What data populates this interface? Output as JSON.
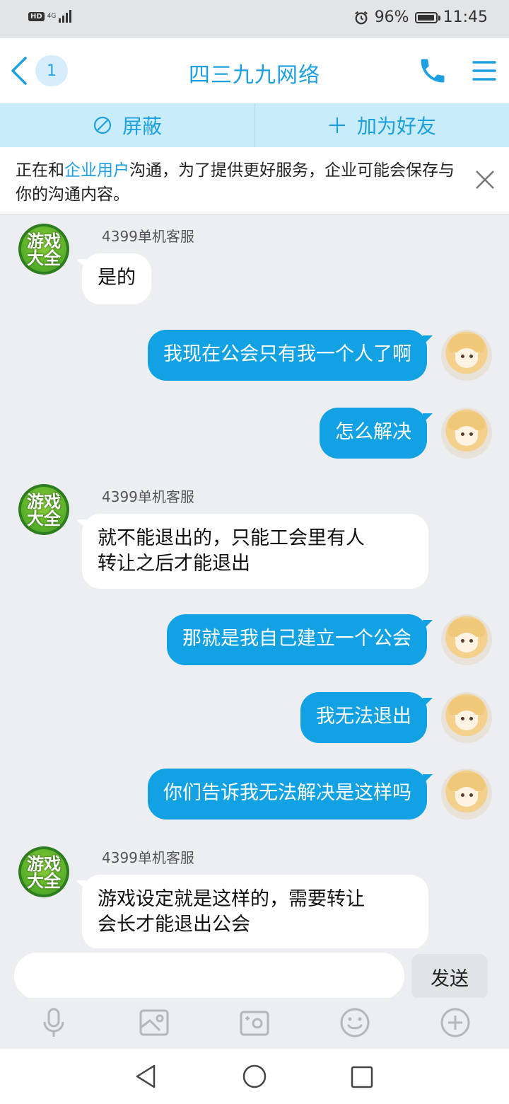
{
  "status_bar": {
    "hd": "HD",
    "network": "4G",
    "battery": "96%",
    "battery_level": 0.96,
    "time": "11:45"
  },
  "header": {
    "back_count": "1",
    "title": "四三九九网络",
    "icons": [
      "back-chevron-icon",
      "phone-icon",
      "menu-icon"
    ]
  },
  "actions": {
    "block_label": "屏蔽",
    "add_friend_label": "加为好友"
  },
  "notice": {
    "text_before": "正在和",
    "highlight": "企业用户",
    "text_after": "沟通，为了提供更好服务，企业可能会保存与你的沟通内容。"
  },
  "messages": [
    {
      "from": "service",
      "sender": "4399单机客服",
      "text": "是的"
    },
    {
      "from": "me",
      "text": "我现在公会只有我一个人了啊"
    },
    {
      "from": "me",
      "text": "怎么解决"
    },
    {
      "from": "service",
      "sender": "4399单机客服",
      "lines": [
        "就不能退出的，只能工会里有人",
        "转让之后才能退出"
      ]
    },
    {
      "from": "me",
      "text": "那就是我自己建立一个公会"
    },
    {
      "from": "me",
      "text": "我无法退出"
    },
    {
      "from": "me",
      "text": "你们告诉我无法解决是这样吗"
    },
    {
      "from": "service",
      "sender": "4399单机客服",
      "lines": [
        "游戏设定就是这样的，需要转让",
        "会长才能退出公会"
      ]
    }
  ],
  "service_avatar": {
    "line1": "游戏",
    "line2": "大全"
  },
  "input": {
    "value": "",
    "send_label": "发送"
  },
  "toolbar": [
    "microphone-icon",
    "image-icon",
    "camera-icon",
    "emoji-icon",
    "plus-icon"
  ],
  "colors": {
    "accent": "#1d9fe0",
    "bubble_out": "#12a2e3",
    "action_bar": "#c9ecfb",
    "background": "#eceef2"
  }
}
